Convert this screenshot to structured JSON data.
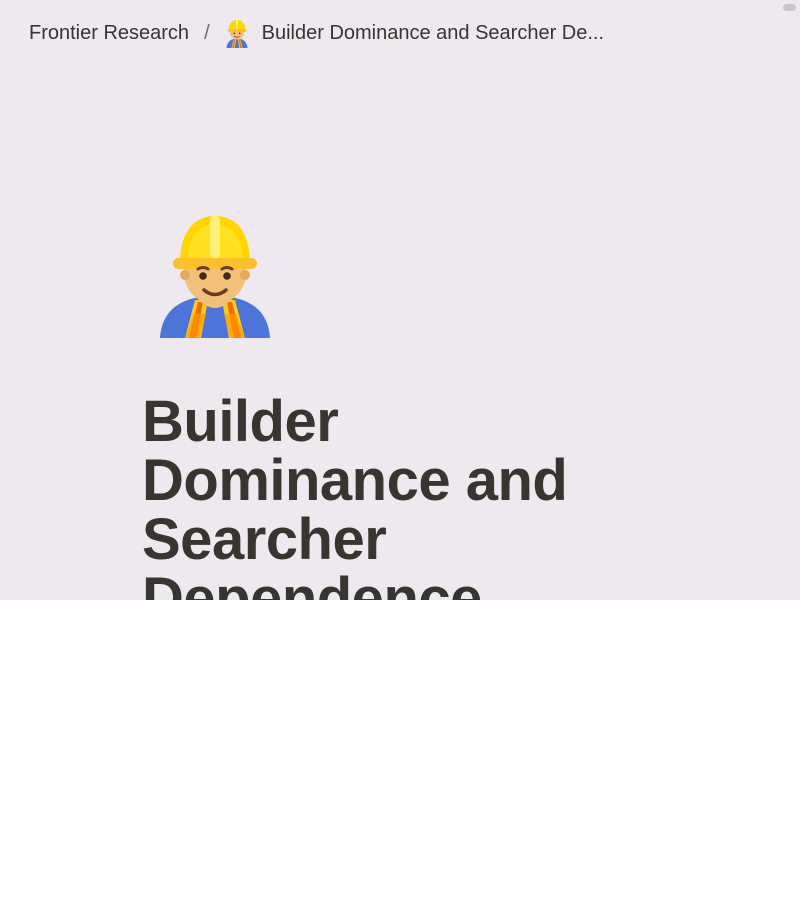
{
  "breadcrumb": {
    "workspace": "Frontier Research",
    "separator": "/",
    "page_title": "Builder Dominance and Searcher De..."
  },
  "page": {
    "icon": "construction-worker-icon",
    "title": "Builder Dominance and Searcher Dependence"
  },
  "colors": {
    "background": "#eee8ef",
    "text": "#37352f",
    "lower_area": "#ffffff"
  }
}
